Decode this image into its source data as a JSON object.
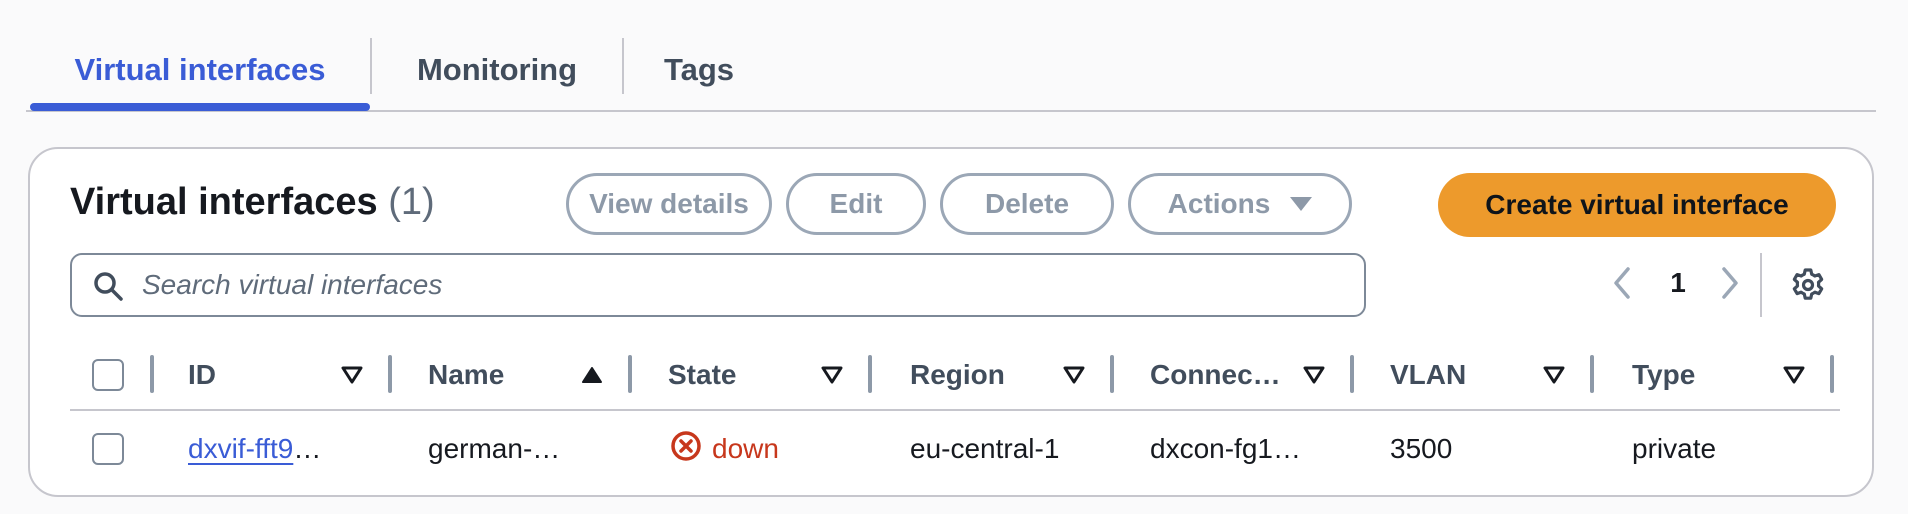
{
  "tabs": [
    {
      "label": "Virtual interfaces",
      "active": true
    },
    {
      "label": "Monitoring",
      "active": false
    },
    {
      "label": "Tags",
      "active": false
    }
  ],
  "header": {
    "title": "Virtual interfaces",
    "count": "(1)"
  },
  "buttons": {
    "view_details": "View details",
    "edit": "Edit",
    "delete": "Delete",
    "actions": "Actions",
    "create": "Create virtual interface"
  },
  "search": {
    "placeholder": "Search virtual interfaces",
    "value": ""
  },
  "pagination": {
    "current_page": "1"
  },
  "table": {
    "columns": [
      {
        "label": "ID",
        "sort": "sortable"
      },
      {
        "label": "Name",
        "sort": "ascending"
      },
      {
        "label": "State",
        "sort": "sortable"
      },
      {
        "label": "Region",
        "sort": "sortable"
      },
      {
        "label": "Connec…",
        "sort": "sortable"
      },
      {
        "label": "VLAN",
        "sort": "sortable"
      },
      {
        "label": "Type",
        "sort": "sortable"
      }
    ],
    "rows": [
      {
        "id_link": "dxvif-fft9",
        "id_rest": "…",
        "name": "german-…",
        "state": "down",
        "region": "eu-central-1",
        "connection": "dxcon-fg1…",
        "vlan": "3500",
        "type": "private"
      }
    ]
  },
  "colors": {
    "accent": "#3a5cd6",
    "primary_button": "#ed9a2c",
    "error": "#c7371c"
  },
  "icons": {
    "search": "search-icon",
    "prev": "chevron-left-icon",
    "next": "chevron-right-icon",
    "settings": "gear-icon",
    "state_error": "x-circle-icon",
    "sort_ascending": "caret-up-filled-icon",
    "sortable": "caret-down-outline-icon"
  }
}
